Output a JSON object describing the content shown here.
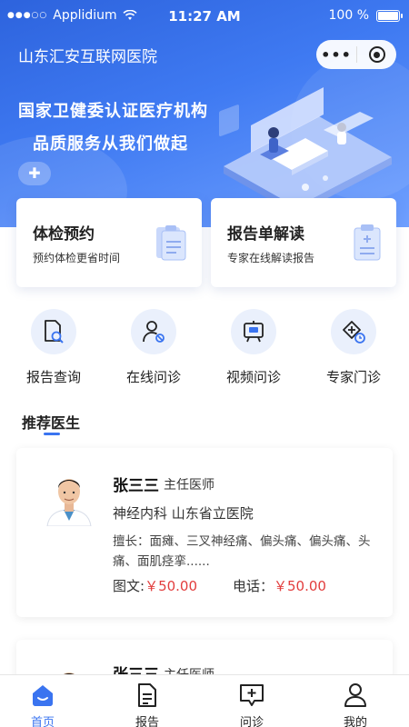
{
  "status_bar": {
    "carrier": "Applidium",
    "time": "11:27 AM",
    "battery": "100 %"
  },
  "nav": {
    "title": "山东汇安互联网医院",
    "more_label": "•••"
  },
  "hero": {
    "slogan_line1": "国家卫健委认证医疗机构",
    "slogan_line2": "品质服务从我们做起"
  },
  "cards": [
    {
      "title": "体检预约",
      "subtitle": "预约体检更省时间",
      "icon": "clipboard-icon"
    },
    {
      "title": "报告单解读",
      "subtitle": "专家在线解读报告",
      "icon": "report-clipboard-icon"
    }
  ],
  "entries": [
    {
      "label": "报告查询",
      "icon": "report-search-icon"
    },
    {
      "label": "在线问诊",
      "icon": "online-consult-icon"
    },
    {
      "label": "视频问诊",
      "icon": "video-consult-icon"
    },
    {
      "label": "专家门诊",
      "icon": "expert-clinic-icon"
    }
  ],
  "section": {
    "title": "推荐医生"
  },
  "doctors": [
    {
      "name": "张三三",
      "title": "主任医师",
      "dept_hospital": "神经内科   山东省立医院",
      "skill": "擅长：面瘫、三叉神经痛、偏头痛、偏头痛、头痛、面肌痉挛......",
      "text_price_label": "图文:",
      "text_price": "￥50.00",
      "phone_price_label": "电话：",
      "phone_price": "￥50.00"
    },
    {
      "name": "张三三",
      "title": "主任医师"
    }
  ],
  "tabbar": [
    {
      "label": "首页",
      "icon": "home-icon",
      "active": true
    },
    {
      "label": "报告",
      "icon": "report-icon",
      "active": false
    },
    {
      "label": "问诊",
      "icon": "consult-icon",
      "active": false
    },
    {
      "label": "我的",
      "icon": "profile-icon",
      "active": false
    }
  ],
  "colors": {
    "primary": "#3a74f0",
    "price": "#e23d3d"
  }
}
